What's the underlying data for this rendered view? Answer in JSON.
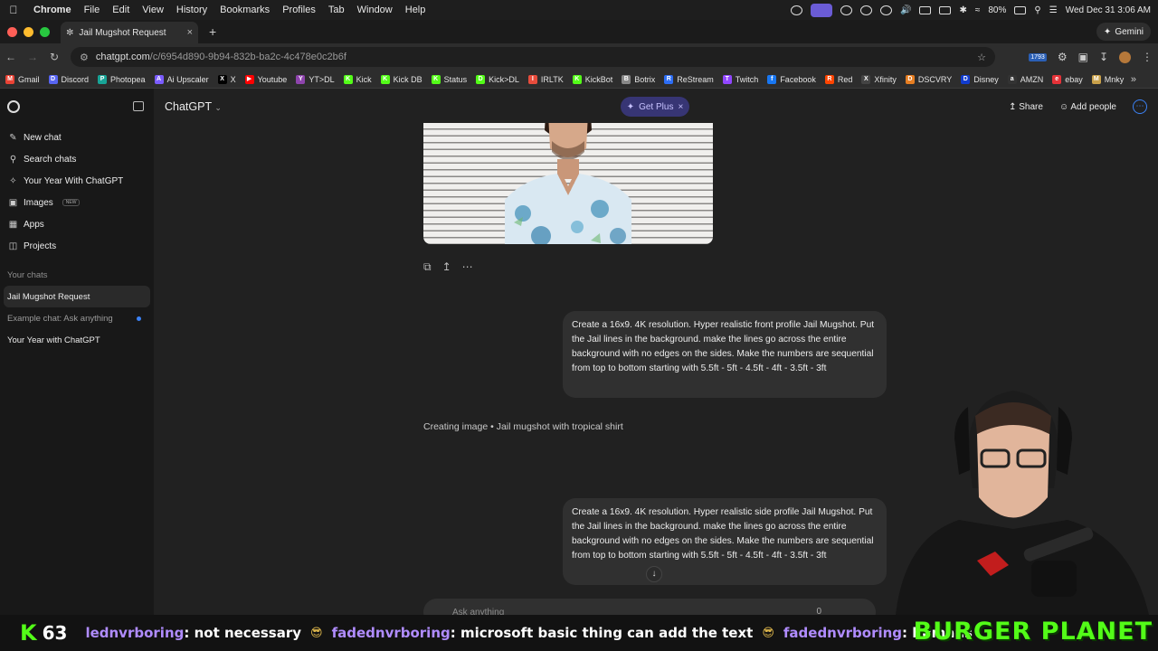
{
  "menubar": {
    "app": "Chrome",
    "items": [
      "File",
      "Edit",
      "View",
      "History",
      "Bookmarks",
      "Profiles",
      "Tab",
      "Window",
      "Help"
    ],
    "battery": "80%",
    "datetime": "Wed Dec 31  3:06 AM"
  },
  "tab": {
    "title": "Jail Mugshot Request",
    "gemini": "Gemini"
  },
  "omnibox": {
    "host": "chatgpt.com",
    "path": "/c/6954d890-9b94-832b-ba2c-4c478e0c2b6f",
    "ext_badge": "1793"
  },
  "bookmarks": [
    {
      "label": "Gmail",
      "color": "#ea4335",
      "glyph": "M"
    },
    {
      "label": "Discord",
      "color": "#5865f2",
      "glyph": "D"
    },
    {
      "label": "Photopea",
      "color": "#18a497",
      "glyph": "P"
    },
    {
      "label": "Ai Upscaler",
      "color": "#7b5cff",
      "glyph": "A"
    },
    {
      "label": "X",
      "color": "#000000",
      "glyph": "X"
    },
    {
      "label": "Youtube",
      "color": "#ff0000",
      "glyph": "▶"
    },
    {
      "label": "YT>DL",
      "color": "#8e44ad",
      "glyph": "Y"
    },
    {
      "label": "Kick",
      "color": "#53fc18",
      "glyph": "K"
    },
    {
      "label": "Kick DB",
      "color": "#53fc18",
      "glyph": "K"
    },
    {
      "label": "Status",
      "color": "#53fc18",
      "glyph": "K"
    },
    {
      "label": "Kick>DL",
      "color": "#53fc18",
      "glyph": "D"
    },
    {
      "label": "IRLTK",
      "color": "#e74c3c",
      "glyph": "I"
    },
    {
      "label": "KickBot",
      "color": "#53fc18",
      "glyph": "K"
    },
    {
      "label": "Botrix",
      "color": "#888888",
      "glyph": "B"
    },
    {
      "label": "ReStream",
      "color": "#2d6ef5",
      "glyph": "R"
    },
    {
      "label": "Twitch",
      "color": "#9146ff",
      "glyph": "T"
    },
    {
      "label": "Facebook",
      "color": "#1877f2",
      "glyph": "f"
    },
    {
      "label": "Red",
      "color": "#ff4500",
      "glyph": "R"
    },
    {
      "label": "Xfinity",
      "color": "#444444",
      "glyph": "X"
    },
    {
      "label": "DSCVRY",
      "color": "#e67e22",
      "glyph": "D"
    },
    {
      "label": "Disney",
      "color": "#113ccf",
      "glyph": "D"
    },
    {
      "label": "AMZN",
      "color": "#333333",
      "glyph": "a"
    },
    {
      "label": "ebay",
      "color": "#e53238",
      "glyph": "e"
    },
    {
      "label": "Mnky",
      "color": "#c9a14a",
      "glyph": "M"
    }
  ],
  "sidebar": {
    "nav": [
      {
        "label": "New chat",
        "icon": "edit-icon"
      },
      {
        "label": "Search chats",
        "icon": "search-icon"
      },
      {
        "label": "Your Year With ChatGPT",
        "icon": "sparkle-icon"
      },
      {
        "label": "Images",
        "icon": "image-icon",
        "tag": "NEW"
      },
      {
        "label": "Apps",
        "icon": "apps-icon"
      },
      {
        "label": "Projects",
        "icon": "folder-icon"
      }
    ],
    "section_label": "Your chats",
    "chats": [
      "Jail Mugshot Request",
      "Example chat: Ask anything",
      "Your Year with ChatGPT"
    ]
  },
  "header": {
    "model": "ChatGPT",
    "get_plus": "Get Plus",
    "share": "Share",
    "add_people": "Add people"
  },
  "messages": {
    "user1": "Create a 16x9. 4K resolution. Hyper realistic front profile Jail Mugshot. Put the Jail lines in the background. make the lines go across the entire background with no edges on the sides. Make the numbers are sequential from top to bottom starting with 5.5ft - 5ft - 4.5ft - 4ft - 3.5ft - 3ft",
    "status": "Creating image • Jail mugshot with tropical shirt",
    "user2": "Create a 16x9. 4K resolution. Hyper realistic side profile Jail Mugshot. Put the Jail lines in the background. make the lines go across the entire background with no edges on the sides. Make the numbers are sequential from top to bottom starting with 5.5ft - 5ft - 4.5ft - 4ft - 3.5ft - 3ft"
  },
  "composer": {
    "placeholder": "Ask anything",
    "counter": "0"
  },
  "ticker": {
    "viewer_count": "63",
    "messages": [
      {
        "user": "lednvrboring",
        "text": ": not necessary"
      },
      {
        "user": "fadednvrboring",
        "text": ": microsoft basic thing can add the text"
      },
      {
        "user": "fadednvrboring",
        "text": ": humans"
      }
    ],
    "brand": "BURGER PLANET"
  }
}
